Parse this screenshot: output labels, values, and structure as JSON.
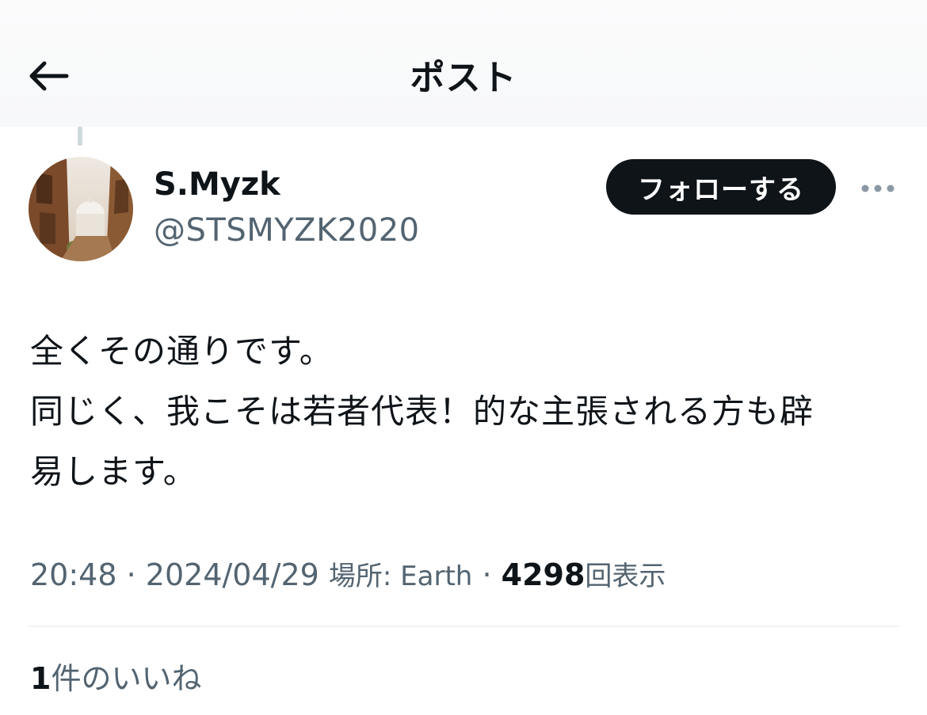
{
  "header": {
    "title": "ポスト"
  },
  "author": {
    "display_name": "S.Myzk",
    "handle": "@STSMYZK2020"
  },
  "follow_button": {
    "label": "フォローする"
  },
  "tweet": {
    "lines": [
      "全くその通りです。",
      "同じく、我こそは若者代表！的な主張される方も辟",
      "易します。"
    ]
  },
  "meta": {
    "time": "20:48",
    "separator": "·",
    "date": "2024/04/29",
    "location_label": "場所: Earth",
    "views_count": "4298",
    "views_label": "回表示"
  },
  "engagement": {
    "likes_count": "1",
    "likes_label": "件のいいね"
  },
  "icons": {
    "back": "arrow-left-icon",
    "more": "more-horizontal-icon"
  },
  "colors": {
    "primary_text": "#0f1419",
    "secondary_text": "#536471",
    "follow_button_bg": "#0f1419",
    "divider": "#eff3f4"
  }
}
